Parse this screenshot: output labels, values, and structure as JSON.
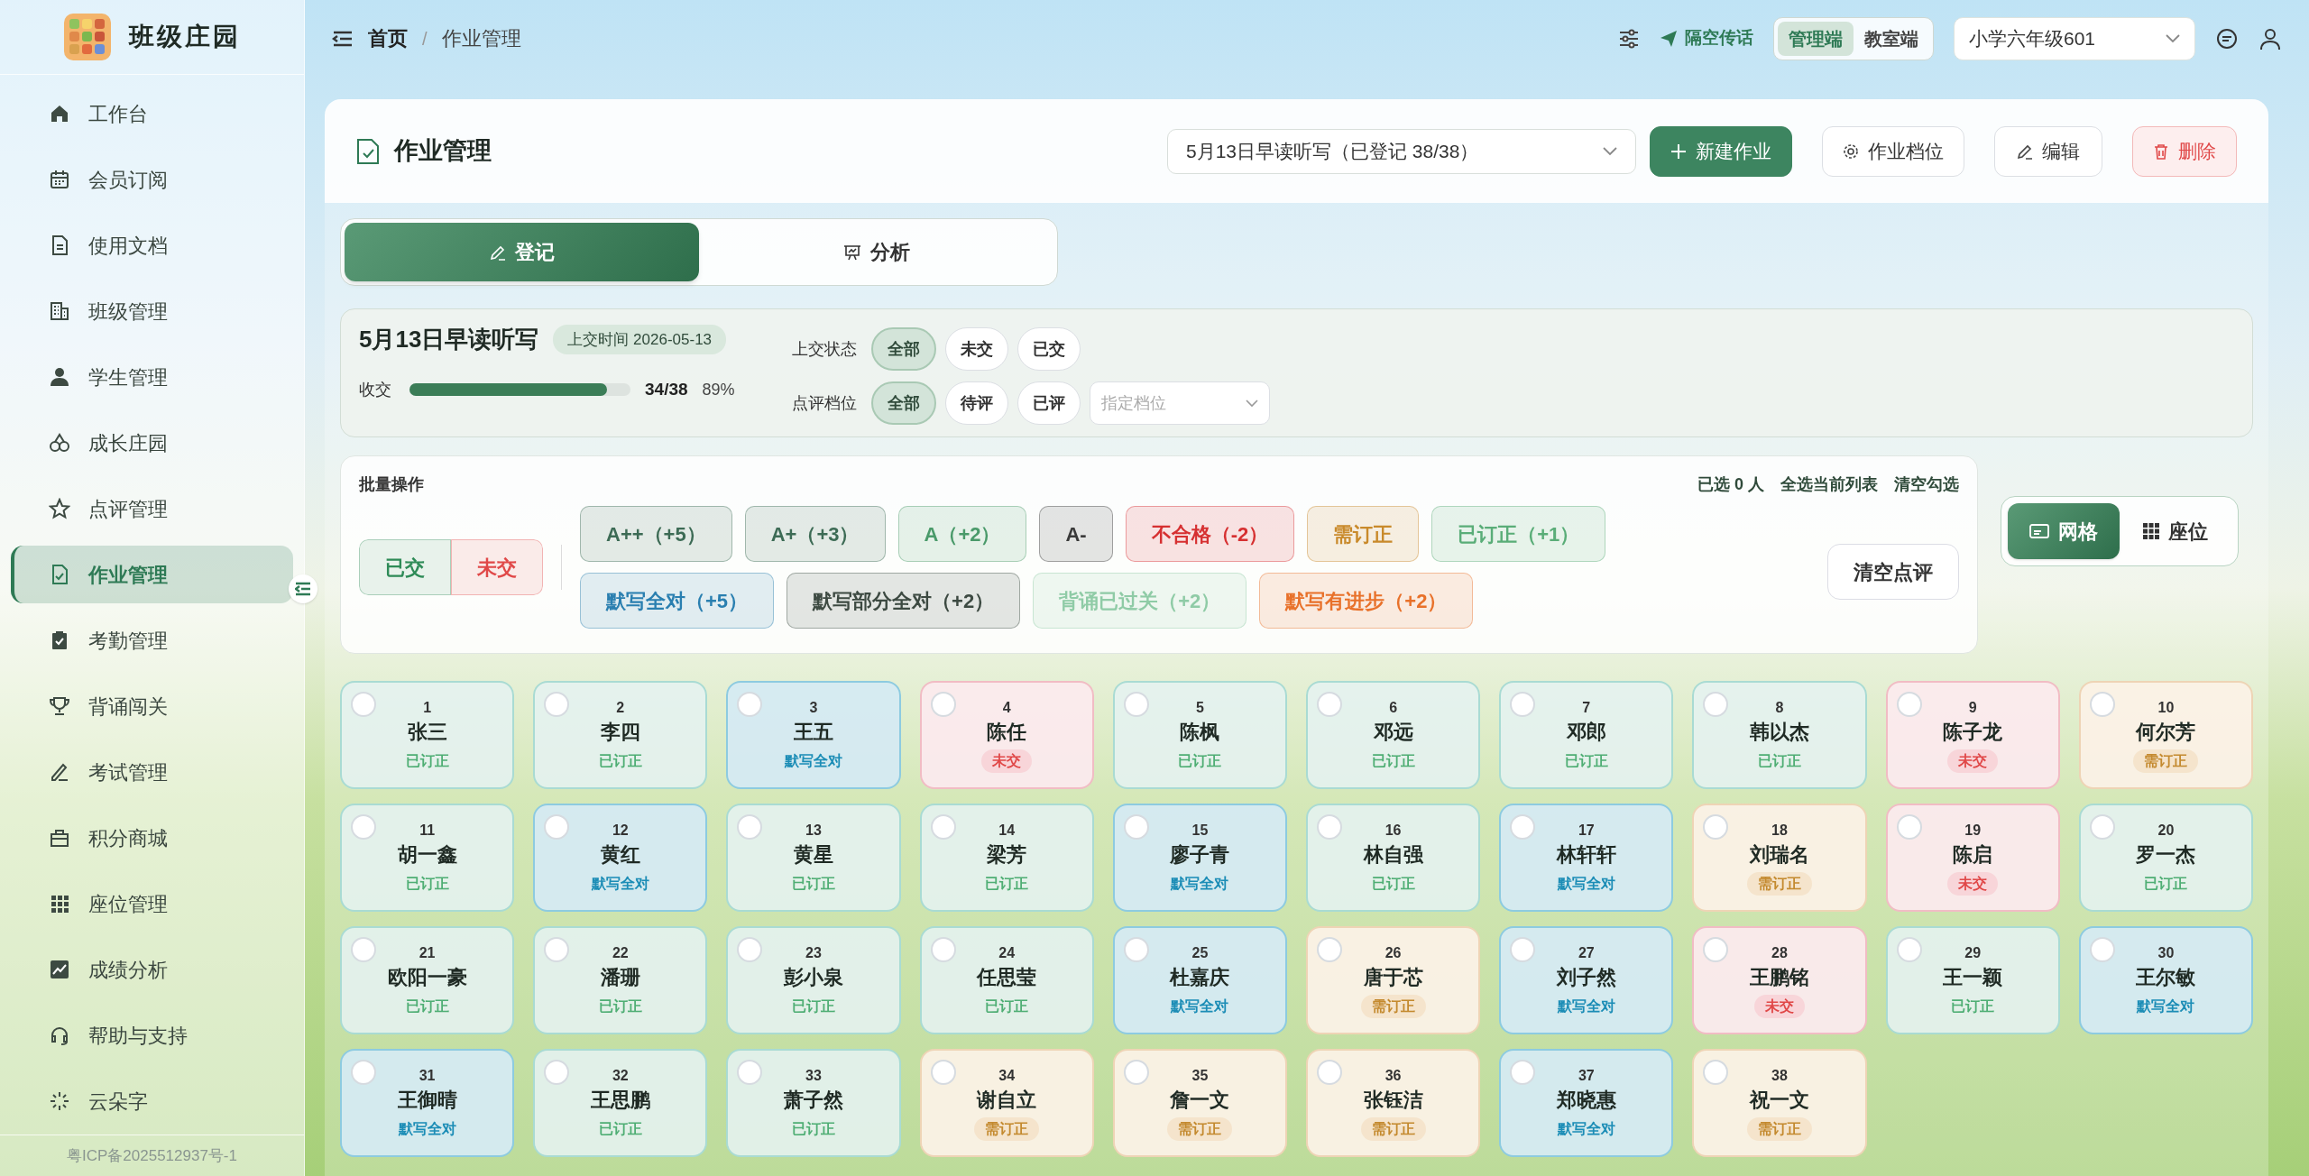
{
  "brand": {
    "title": "班级庄园"
  },
  "sidebar": {
    "items": [
      {
        "label": "工作台",
        "selected": false
      },
      {
        "label": "会员订阅",
        "selected": false
      },
      {
        "label": "使用文档",
        "selected": false
      },
      {
        "label": "班级管理",
        "selected": false
      },
      {
        "label": "学生管理",
        "selected": false
      },
      {
        "label": "成长庄园",
        "selected": false
      },
      {
        "label": "点评管理",
        "selected": false
      },
      {
        "label": "作业管理",
        "selected": true
      },
      {
        "label": "考勤管理",
        "selected": false
      },
      {
        "label": "背诵闯关",
        "selected": false
      },
      {
        "label": "考试管理",
        "selected": false
      },
      {
        "label": "积分商城",
        "selected": false
      },
      {
        "label": "座位管理",
        "selected": false
      },
      {
        "label": "成绩分析",
        "selected": false
      },
      {
        "label": "帮助与支持",
        "selected": false
      },
      {
        "label": "云朵字",
        "selected": false
      }
    ],
    "footer": "粤ICP备2025512937号-1"
  },
  "header": {
    "breadcrumb": [
      "首页",
      "作业管理"
    ],
    "breadcrumb_separator": "/",
    "broadcast": "隔空传话",
    "modes": [
      {
        "label": "管理端",
        "selected": true
      },
      {
        "label": "教室端",
        "selected": false
      }
    ],
    "class_select": "小学六年级601"
  },
  "page": {
    "title": "作业管理",
    "assignment_select": "5月13日早读听写（已登记 38/38）",
    "actions": [
      {
        "label": "新建作业",
        "kind": "primary"
      },
      {
        "label": "作业档位",
        "kind": "settings"
      },
      {
        "label": "编辑",
        "kind": "edit"
      },
      {
        "label": "删除",
        "kind": "delete"
      }
    ]
  },
  "tabs": [
    {
      "label": "登记",
      "selected": true
    },
    {
      "label": "分析",
      "selected": false
    }
  ],
  "summary": {
    "title": "5月13日早读听写",
    "submit_time": "上交时间 2026-05-13",
    "collect_label": "收交",
    "level": 0.895,
    "count": "34/38",
    "percent": "89%",
    "filters": [
      {
        "label": "上交状态",
        "options": [
          {
            "label": "全部",
            "selected": true
          },
          {
            "label": "未交",
            "selected": false
          },
          {
            "label": "已交",
            "selected": false
          }
        ]
      },
      {
        "label": "点评档位",
        "options": [
          {
            "label": "全部",
            "selected": true
          },
          {
            "label": "待评",
            "selected": false
          },
          {
            "label": "已评",
            "selected": false
          }
        ],
        "placeholder": "指定档位"
      }
    ]
  },
  "batch": {
    "title": "批量操作",
    "selected_count": "已选 0 人",
    "select_all": "全选当前列表",
    "clear_selection": "清空勾选",
    "submit_buttons": [
      {
        "label": "已交",
        "color": "#2e8b57"
      },
      {
        "label": "未交",
        "color": "#e04848"
      }
    ],
    "grades": [
      {
        "label": "A++（+5）",
        "color": "#3d6b55"
      },
      {
        "label": "A+（+3）",
        "color": "#3d6b55"
      },
      {
        "label": "A（+2）",
        "color": "#4a9a6a"
      },
      {
        "label": "A-",
        "color": "#3a3a3a"
      },
      {
        "label": "不合格（-2）",
        "color": "#d63031"
      },
      {
        "label": "需订正",
        "color": "#c98a2b"
      },
      {
        "label": "已订正（+1）",
        "color": "#5aad78"
      },
      {
        "label": "默写全对（+5）",
        "color": "#2a7fb0"
      },
      {
        "label": "默写部分全对（+2）",
        "color": "#3d4a42"
      },
      {
        "label": "背诵已过关（+2）",
        "color": "#8fcba6"
      },
      {
        "label": "默写有进步（+2）",
        "color": "#e8712a"
      }
    ],
    "clear_reviews": "清空点评"
  },
  "view_toggle": [
    {
      "label": "网格",
      "selected": true
    },
    {
      "label": "座位",
      "selected": false
    }
  ],
  "students": [
    {
      "number": "1",
      "name": "张三",
      "status": "已订正",
      "kind": "corrected",
      "selected": false
    },
    {
      "number": "2",
      "name": "李四",
      "status": "已订正",
      "kind": "corrected",
      "selected": false
    },
    {
      "number": "3",
      "name": "王五",
      "status": "默写全对",
      "kind": "all_correct",
      "selected": false
    },
    {
      "number": "4",
      "name": "陈任",
      "status": "未交",
      "kind": "not_submitted",
      "selected": false
    },
    {
      "number": "5",
      "name": "陈枫",
      "status": "已订正",
      "kind": "corrected",
      "selected": false
    },
    {
      "number": "6",
      "name": "邓远",
      "status": "已订正",
      "kind": "corrected",
      "selected": false
    },
    {
      "number": "7",
      "name": "邓郎",
      "status": "已订正",
      "kind": "corrected",
      "selected": false
    },
    {
      "number": "8",
      "name": "韩以杰",
      "status": "已订正",
      "kind": "corrected",
      "selected": false
    },
    {
      "number": "9",
      "name": "陈子龙",
      "status": "未交",
      "kind": "not_submitted",
      "selected": false
    },
    {
      "number": "10",
      "name": "何尔芳",
      "status": "需订正",
      "kind": "needs_correction",
      "selected": false
    },
    {
      "number": "11",
      "name": "胡一鑫",
      "status": "已订正",
      "kind": "corrected",
      "selected": false
    },
    {
      "number": "12",
      "name": "黄红",
      "status": "默写全对",
      "kind": "all_correct",
      "selected": false
    },
    {
      "number": "13",
      "name": "黄星",
      "status": "已订正",
      "kind": "corrected",
      "selected": false
    },
    {
      "number": "14",
      "name": "梁芳",
      "status": "已订正",
      "kind": "corrected",
      "selected": false
    },
    {
      "number": "15",
      "name": "廖子青",
      "status": "默写全对",
      "kind": "all_correct",
      "selected": false
    },
    {
      "number": "16",
      "name": "林自强",
      "status": "已订正",
      "kind": "corrected",
      "selected": false
    },
    {
      "number": "17",
      "name": "林轩轩",
      "status": "默写全对",
      "kind": "all_correct",
      "selected": false
    },
    {
      "number": "18",
      "name": "刘瑞名",
      "status": "需订正",
      "kind": "needs_correction",
      "selected": false
    },
    {
      "number": "19",
      "name": "陈启",
      "status": "未交",
      "kind": "not_submitted",
      "selected": false
    },
    {
      "number": "20",
      "name": "罗一杰",
      "status": "已订正",
      "kind": "corrected",
      "selected": false
    },
    {
      "number": "21",
      "name": "欧阳一豪",
      "status": "已订正",
      "kind": "corrected",
      "selected": false
    },
    {
      "number": "22",
      "name": "潘珊",
      "status": "已订正",
      "kind": "corrected",
      "selected": false
    },
    {
      "number": "23",
      "name": "彭小泉",
      "status": "已订正",
      "kind": "corrected",
      "selected": false
    },
    {
      "number": "24",
      "name": "任思莹",
      "status": "已订正",
      "kind": "corrected",
      "selected": false
    },
    {
      "number": "25",
      "name": "杜嘉庆",
      "status": "默写全对",
      "kind": "all_correct",
      "selected": false
    },
    {
      "number": "26",
      "name": "唐于芯",
      "status": "需订正",
      "kind": "needs_correction",
      "selected": false
    },
    {
      "number": "27",
      "name": "刘子然",
      "status": "默写全对",
      "kind": "all_correct",
      "selected": false
    },
    {
      "number": "28",
      "name": "王鹏铭",
      "status": "未交",
      "kind": "not_submitted",
      "selected": false
    },
    {
      "number": "29",
      "name": "王一颖",
      "status": "已订正",
      "kind": "corrected",
      "selected": false
    },
    {
      "number": "30",
      "name": "王尔敏",
      "status": "默写全对",
      "kind": "all_correct",
      "selected": false
    },
    {
      "number": "31",
      "name": "王御晴",
      "status": "默写全对",
      "kind": "all_correct",
      "selected": false
    },
    {
      "number": "32",
      "name": "王思鹏",
      "status": "已订正",
      "kind": "corrected",
      "selected": false
    },
    {
      "number": "33",
      "name": "萧子然",
      "status": "已订正",
      "kind": "corrected",
      "selected": false
    },
    {
      "number": "34",
      "name": "谢自立",
      "status": "需订正",
      "kind": "needs_correction",
      "selected": false
    },
    {
      "number": "35",
      "name": "詹一文",
      "status": "需订正",
      "kind": "needs_correction",
      "selected": false
    },
    {
      "number": "36",
      "name": "张钰洁",
      "status": "需订正",
      "kind": "needs_correction",
      "selected": false
    },
    {
      "number": "37",
      "name": "郑晓惠",
      "status": "默写全对",
      "kind": "all_correct",
      "selected": false
    },
    {
      "number": "38",
      "name": "祝一文",
      "status": "需订正",
      "kind": "needs_correction",
      "selected": false
    }
  ]
}
